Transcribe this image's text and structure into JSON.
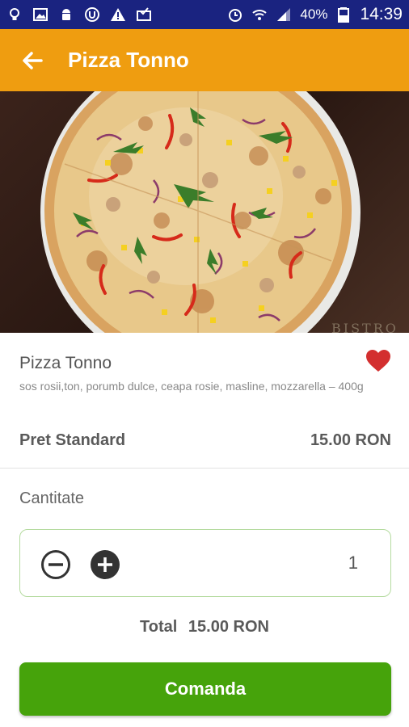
{
  "status_bar": {
    "battery": "40%",
    "time": "14:39",
    "icons": [
      "lightbulb-icon",
      "image-icon",
      "android-icon",
      "circle-u-icon",
      "warning-icon",
      "mail-check-icon",
      "alarm-icon",
      "wifi-icon",
      "signal-icon",
      "battery-icon"
    ]
  },
  "app_bar": {
    "title": "Pizza Tonno",
    "back_icon": "arrow-left-icon"
  },
  "product": {
    "name": "Pizza Tonno",
    "description": "sos rosii,ton, porumb dulce, ceapa rosie, masline, mozzarella – 400g",
    "price_label": "Pret Standard",
    "price_value": "15.00 RON",
    "favorite_icon": "heart-icon",
    "image_watermark": "BISTRO"
  },
  "quantity": {
    "label": "Cantitate",
    "value": "1"
  },
  "total": {
    "label": "Total",
    "value": "15.00 RON"
  },
  "order_button": {
    "label": "Comanda"
  },
  "colors": {
    "status_bar": "#1a2380",
    "app_bar": "#ef9d10",
    "accent_green": "#46a30b",
    "heart_red": "#d32f2f"
  }
}
